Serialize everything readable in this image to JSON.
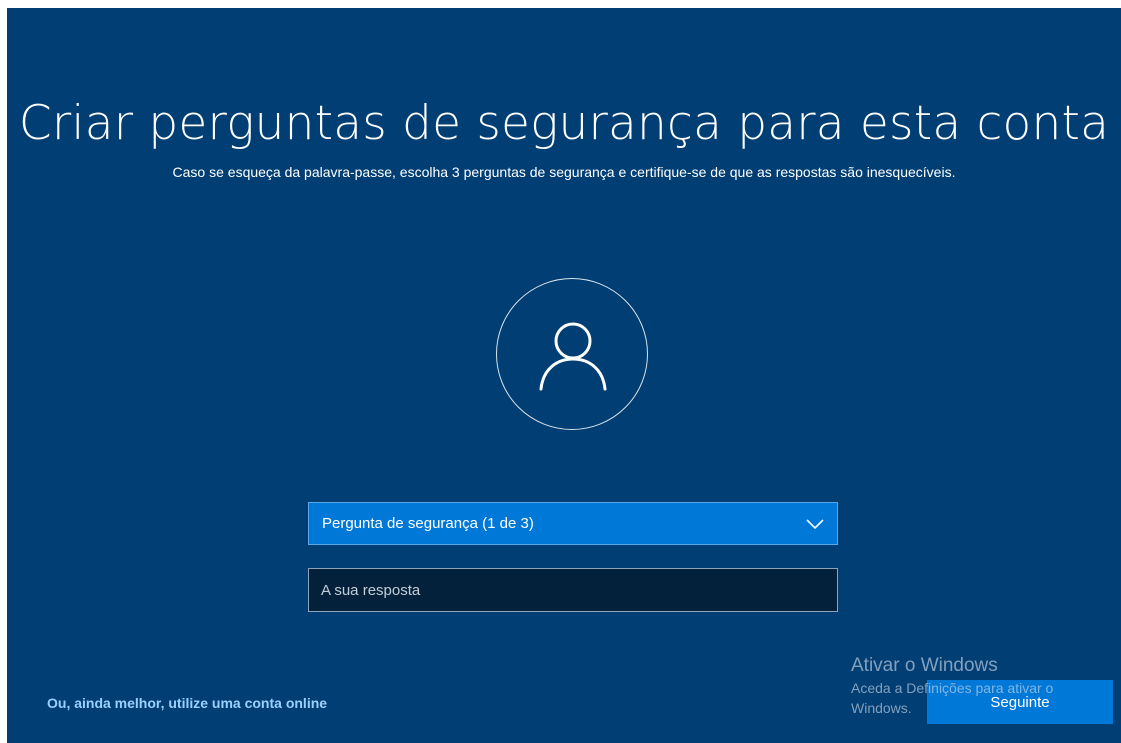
{
  "page": {
    "title": "Criar perguntas de segurança para esta conta",
    "subtitle": "Caso se esqueça da palavra-passe, escolha 3 perguntas de segurança e certifique-se de que as respostas são inesquecíveis."
  },
  "form": {
    "question_select": {
      "selected": "Pergunta de segurança (1 de 3)"
    },
    "answer": {
      "placeholder": "A sua resposta",
      "value": ""
    }
  },
  "footer": {
    "online_account_link": "Ou, ainda melhor, utilize uma conta online",
    "next_button": "Seguinte"
  },
  "watermark": {
    "title": "Ativar o Windows",
    "text": "Aceda a Definições para ativar o Windows."
  },
  "icons": {
    "avatar": "user-icon",
    "dropdown": "chevron-down-icon"
  },
  "colors": {
    "background": "#003e74",
    "accent": "#0078d7",
    "link": "#9ad0ff"
  }
}
